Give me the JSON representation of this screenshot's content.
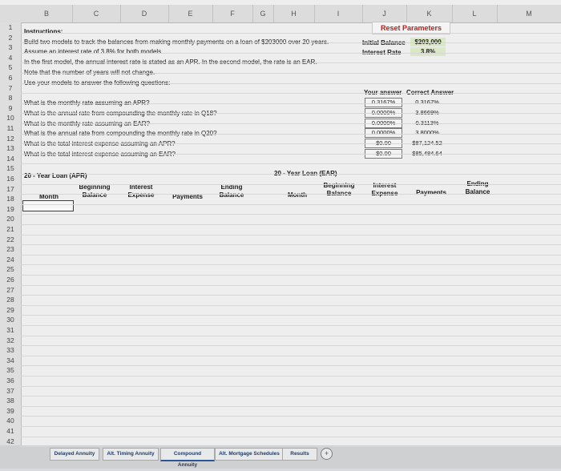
{
  "columns": [
    "B",
    "C",
    "D",
    "E",
    "F",
    "G",
    "H",
    "I",
    "J",
    "K",
    "L",
    "M"
  ],
  "rows": [
    "1",
    "2",
    "3",
    "4",
    "5",
    "6",
    "7",
    "8",
    "9",
    "10",
    "11",
    "12",
    "13",
    "14",
    "15",
    "16",
    "17",
    "18",
    "19",
    "20",
    "21",
    "22",
    "23",
    "24",
    "25",
    "26",
    "27",
    "28",
    "29",
    "30",
    "31",
    "32",
    "33",
    "34",
    "35",
    "36",
    "37",
    "38",
    "39",
    "40",
    "41",
    "42"
  ],
  "instructions": {
    "heading": "Instructions:",
    "lines": [
      "Build two models to track the balances from making monthly payments on a loan of $203000 over 20 years.",
      "Assume an interest rate of 3.8% for both models.",
      "In the first model, the annual interest rate is stated as an APR. In the second model, the rate is an EAR.",
      "Note that the number of years will not change.",
      "Use your models to answer the following questions:"
    ],
    "questions": [
      "What is the monthly rate assuming an APR?",
      "What is the annual rate from compounding the monthly rate in Q18?",
      "What is the monthly rate assuming an EAR?",
      "What is the annual rate from compounding the monthly rate in Q20?",
      "What is the total interest expense assuming an APR?",
      "What is the total interest expense assuming an EAR?"
    ]
  },
  "reset_button": "Reset Parameters",
  "parameters": {
    "initial_balance_label": "Initial Balance",
    "initial_balance_value": "$203,000",
    "interest_rate_label": "Interest Rate",
    "interest_rate_value": "3.8%"
  },
  "answers": {
    "your_answer_header": "Your answer",
    "correct_answer_header": "Correct Answer",
    "your_answers": [
      "0.3167%",
      "0.0000%",
      "0.0000%",
      "0.0000%",
      "$0.00",
      "$0.00"
    ],
    "correct_answers": [
      "0.3167%",
      "3.8669%",
      "0.3113%",
      "3.8000%",
      "$87,124.52",
      "$85,484.64"
    ]
  },
  "apr_table": {
    "title": "20 - Year Loan (APR)",
    "headers": [
      "Month",
      "Beginning Balance",
      "Interest Expense",
      "Payments",
      "Ending Balance"
    ]
  },
  "ear_table": {
    "title": "20 - Year Loan (EAR)",
    "headers": [
      "Month",
      "Beginning Balance",
      "Interest Expense",
      "Payments",
      "Ending Balance"
    ]
  },
  "tabs": [
    "Delayed Annuity",
    "Alt. Timing Annuity",
    "Compound Annuity",
    "Alt. Mortgage Schedules",
    "Results"
  ],
  "add_tab": "+"
}
